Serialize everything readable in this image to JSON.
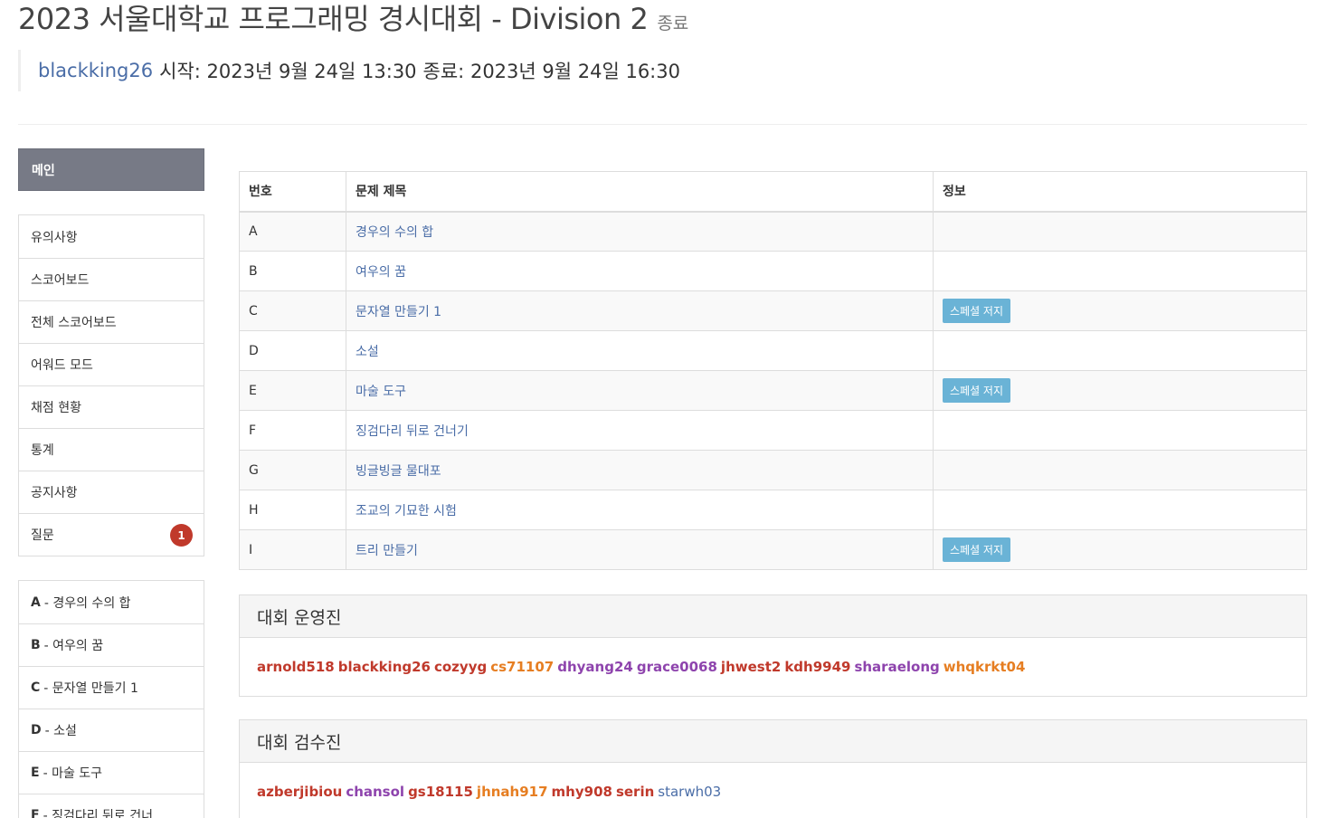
{
  "header": {
    "title": "2023 서울대학교 프로그래밍 경시대회 - Division 2",
    "status": "종료",
    "author": "blackking26",
    "start_label": "시작:",
    "start_time": "2023년 9월 24일 13:30",
    "end_label": "종료:",
    "end_time": "2023년 9월 24일 16:30"
  },
  "sidebar": {
    "main": "메인",
    "menu": [
      {
        "label": "유의사항"
      },
      {
        "label": "스코어보드"
      },
      {
        "label": "전체 스코어보드"
      },
      {
        "label": "어워드 모드"
      },
      {
        "label": "채점 현황"
      },
      {
        "label": "통계"
      },
      {
        "label": "공지사항"
      },
      {
        "label": "질문",
        "badge": "1"
      }
    ],
    "problems": [
      {
        "letter": "A",
        "title": "- 경우의 수의 합"
      },
      {
        "letter": "B",
        "title": "- 여우의 꿈"
      },
      {
        "letter": "C",
        "title": "- 문자열 만들기 1"
      },
      {
        "letter": "D",
        "title": "- 소설"
      },
      {
        "letter": "E",
        "title": "- 마술 도구"
      },
      {
        "letter": "F",
        "title": "- 징검다리 뒤로 건너"
      }
    ]
  },
  "table": {
    "headers": [
      "번호",
      "문제 제목",
      "정보"
    ],
    "rows": [
      {
        "id": "A",
        "title": "경우의 수의 합",
        "info": ""
      },
      {
        "id": "B",
        "title": "여우의 꿈",
        "info": ""
      },
      {
        "id": "C",
        "title": "문자열 만들기 1",
        "info": "스페셜 저지"
      },
      {
        "id": "D",
        "title": "소설",
        "info": ""
      },
      {
        "id": "E",
        "title": "마술 도구",
        "info": "스페셜 저지"
      },
      {
        "id": "F",
        "title": "징검다리 뒤로 건너기",
        "info": ""
      },
      {
        "id": "G",
        "title": "빙글빙글 물대포",
        "info": ""
      },
      {
        "id": "H",
        "title": "조교의 기묘한 시험",
        "info": ""
      },
      {
        "id": "I",
        "title": "트리 만들기",
        "info": "스페셜 저지"
      }
    ]
  },
  "staff": {
    "title": "대회 운영진",
    "users": [
      {
        "name": "arnold518",
        "color": "red"
      },
      {
        "name": "blackking26",
        "color": "red"
      },
      {
        "name": "cozyyg",
        "color": "red"
      },
      {
        "name": "cs71107",
        "color": "orange"
      },
      {
        "name": "dhyang24",
        "color": "purple"
      },
      {
        "name": "grace0068",
        "color": "purple"
      },
      {
        "name": "jhwest2",
        "color": "red"
      },
      {
        "name": "kdh9949",
        "color": "red"
      },
      {
        "name": "sharaelong",
        "color": "purple"
      },
      {
        "name": "whqkrkt04",
        "color": "orange"
      }
    ]
  },
  "testers": {
    "title": "대회 검수진",
    "users": [
      {
        "name": "azberjibiou",
        "color": "red"
      },
      {
        "name": "chansol",
        "color": "purple"
      },
      {
        "name": "gs18115",
        "color": "red"
      },
      {
        "name": "jhnah917",
        "color": "orange"
      },
      {
        "name": "mhy908",
        "color": "red"
      },
      {
        "name": "serin",
        "color": "red"
      },
      {
        "name": "starwh03",
        "color": "blue"
      }
    ]
  },
  "colors": {
    "red": "#c0392b",
    "orange": "#e67e22",
    "purple": "#8e44ad",
    "blue": "#4a6da7",
    "sidebar_active": "#777a86",
    "special_judge": "#6ab3d6"
  }
}
